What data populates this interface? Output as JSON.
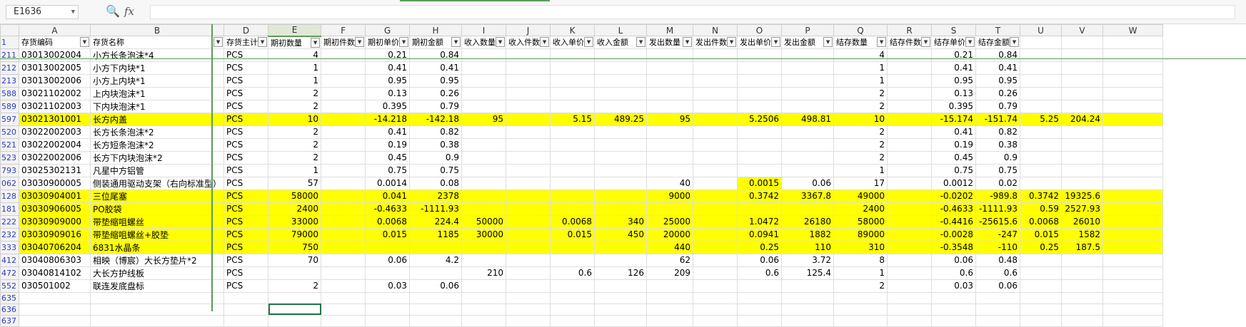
{
  "formula_bar": {
    "name_box": "E1636",
    "zoom_icon": "zoom-icon",
    "fx_label": "fx",
    "formula_value": ""
  },
  "sheet": {
    "columns": [
      "A",
      "B",
      "D",
      "E",
      "F",
      "G",
      "H",
      "I",
      "J",
      "K",
      "L",
      "M",
      "N",
      "O",
      "P",
      "Q",
      "R",
      "S",
      "T",
      "U",
      "V",
      "W"
    ],
    "header_row_number": "1",
    "headers": [
      "存货编码",
      "存货名称",
      "存货主计",
      "期初数量",
      "期初件数",
      "期初单价",
      "期初金额",
      "收入数量",
      "收入件数",
      "收入单价",
      "收入金额",
      "发出数量",
      "发出件数",
      "发出单价",
      "发出金额",
      "结存数量",
      "结存件数",
      "结存单价",
      "结存金额",
      "",
      "",
      ""
    ],
    "rows": [
      {
        "rn": "211",
        "hl": false,
        "cells": [
          "03013002004",
          "小方长条泡沫*4",
          "PCS",
          "4",
          "",
          "0.21",
          "0.84",
          "",
          "",
          "",
          "",
          "",
          "",
          "",
          "",
          "4",
          "",
          "0.21",
          "0.84",
          "",
          "",
          ""
        ]
      },
      {
        "rn": "212",
        "hl": false,
        "cells": [
          "03013002005",
          "小方下内块*1",
          "PCS",
          "1",
          "",
          "0.41",
          "0.41",
          "",
          "",
          "",
          "",
          "",
          "",
          "",
          "",
          "1",
          "",
          "0.41",
          "0.41",
          "",
          "",
          ""
        ]
      },
      {
        "rn": "213",
        "hl": false,
        "cells": [
          "03013002006",
          "小方上内块*1",
          "PCS",
          "1",
          "",
          "0.95",
          "0.95",
          "",
          "",
          "",
          "",
          "",
          "",
          "",
          "",
          "1",
          "",
          "0.95",
          "0.95",
          "",
          "",
          ""
        ]
      },
      {
        "rn": "588",
        "hl": false,
        "cells": [
          "03021102002",
          "上内块泡沫*1",
          "PCS",
          "2",
          "",
          "0.13",
          "0.26",
          "",
          "",
          "",
          "",
          "",
          "",
          "",
          "",
          "2",
          "",
          "0.13",
          "0.26",
          "",
          "",
          ""
        ]
      },
      {
        "rn": "589",
        "hl": false,
        "cells": [
          "03021102003",
          "下内块泡沫*1",
          "PCS",
          "2",
          "",
          "0.395",
          "0.79",
          "",
          "",
          "",
          "",
          "",
          "",
          "",
          "",
          "2",
          "",
          "0.395",
          "0.79",
          "",
          "",
          ""
        ]
      },
      {
        "rn": "597",
        "hl": true,
        "cells": [
          "03021301001",
          "长方内盖",
          "PCS",
          "10",
          "",
          "-14.218",
          "-142.18",
          "95",
          "",
          "5.15",
          "489.25",
          "95",
          "",
          "5.2506",
          "498.81",
          "10",
          "",
          "-15.174",
          "-151.74",
          "5.25",
          "204.24",
          ""
        ]
      },
      {
        "rn": "520",
        "hl": false,
        "cells": [
          "03022002003",
          "长方长条泡沫*2",
          "PCS",
          "2",
          "",
          "0.41",
          "0.82",
          "",
          "",
          "",
          "",
          "",
          "",
          "",
          "",
          "2",
          "",
          "0.41",
          "0.82",
          "",
          "",
          ""
        ]
      },
      {
        "rn": "521",
        "hl": false,
        "cells": [
          "03022002004",
          "长方短条泡沫*2",
          "PCS",
          "2",
          "",
          "0.19",
          "0.38",
          "",
          "",
          "",
          "",
          "",
          "",
          "",
          "",
          "2",
          "",
          "0.19",
          "0.38",
          "",
          "",
          ""
        ]
      },
      {
        "rn": "523",
        "hl": false,
        "cells": [
          "03022002006",
          "长方下内块泡沫*2",
          "PCS",
          "2",
          "",
          "0.45",
          "0.9",
          "",
          "",
          "",
          "",
          "",
          "",
          "",
          "",
          "2",
          "",
          "0.45",
          "0.9",
          "",
          "",
          ""
        ]
      },
      {
        "rn": "793",
        "hl": false,
        "cells": [
          "03025302131",
          "凡星中方铝管",
          "PCS",
          "1",
          "",
          "0.75",
          "0.75",
          "",
          "",
          "",
          "",
          "",
          "",
          "",
          "",
          "1",
          "",
          "0.75",
          "0.75",
          "",
          "",
          ""
        ]
      },
      {
        "rn": "062",
        "hl": false,
        "cells": [
          "03030900005",
          "侧装通用驱动支架（右向标准型）",
          "PCS",
          "57",
          "",
          "0.0014",
          "0.08",
          "",
          "",
          "",
          "",
          "40",
          "",
          "0.0015",
          "0.06",
          "17",
          "",
          "0.0012",
          "0.02",
          "",
          "",
          ""
        ]
      },
      {
        "rn": "128",
        "hl": true,
        "cells": [
          "03030904001",
          "三位尾塞",
          "PCS",
          "58000",
          "",
          "0.041",
          "2378",
          "",
          "",
          "",
          "",
          "9000",
          "",
          "0.3742",
          "3367.8",
          "49000",
          "",
          "-0.0202",
          "-989.8",
          "0.3742",
          "19325.6",
          ""
        ]
      },
      {
        "rn": "181",
        "hl": true,
        "cells": [
          "03030906005",
          "PO胶袋",
          "PCS",
          "2400",
          "",
          "-0.4633",
          "-1111.93",
          "",
          "",
          "",
          "",
          "",
          "",
          "",
          "",
          "2400",
          "",
          "-0.4633",
          "-1111.93",
          "0.59",
          "2527.93",
          ""
        ]
      },
      {
        "rn": "222",
        "hl": true,
        "cells": [
          "03030909000",
          "带垫缩咀螺丝",
          "PCS",
          "33000",
          "",
          "0.0068",
          "224.4",
          "50000",
          "",
          "0.0068",
          "340",
          "25000",
          "",
          "1.0472",
          "26180",
          "58000",
          "",
          "-0.4416",
          "-25615.6",
          "0.0068",
          "26010",
          ""
        ]
      },
      {
        "rn": "232",
        "hl": true,
        "cells": [
          "03030909016",
          "带垫缩咀螺丝+胶垫",
          "PCS",
          "79000",
          "",
          "0.015",
          "1185",
          "30000",
          "",
          "0.015",
          "450",
          "20000",
          "",
          "0.0941",
          "1882",
          "89000",
          "",
          "-0.0028",
          "-247",
          "0.015",
          "1582",
          ""
        ]
      },
      {
        "rn": "333",
        "hl": true,
        "cells": [
          "03040706204",
          "6831水晶条",
          "PCS",
          "750",
          "",
          "",
          "",
          "",
          "",
          "",
          "",
          "440",
          "",
          "0.25",
          "110",
          "310",
          "",
          "-0.3548",
          "-110",
          "0.25",
          "187.5",
          ""
        ]
      },
      {
        "rn": "412",
        "hl": false,
        "cells": [
          "03040806303",
          "相映（博宸）大长方垫片*2",
          "PCS",
          "70",
          "",
          "0.06",
          "4.2",
          "",
          "",
          "",
          "",
          "62",
          "",
          "0.06",
          "3.72",
          "8",
          "",
          "0.06",
          "0.48",
          "",
          "",
          ""
        ]
      },
      {
        "rn": "472",
        "hl": false,
        "cells": [
          "03040814102",
          "大长方护线板",
          "PCS",
          "",
          "",
          "",
          "",
          "210",
          "",
          "0.6",
          "126",
          "209",
          "",
          "0.6",
          "125.4",
          "1",
          "",
          "0.6",
          "0.6",
          "",
          "",
          ""
        ]
      },
      {
        "rn": "552",
        "hl": false,
        "cells": [
          "030501002",
          "联连发底盘标",
          "PCS",
          "2",
          "",
          "0.03",
          "0.06",
          "",
          "",
          "",
          "",
          "",
          "",
          "",
          "",
          "2",
          "",
          "0.03",
          "0.06",
          "",
          "",
          ""
        ]
      },
      {
        "rn": "635",
        "hl": false,
        "cells": [
          "",
          "",
          "",
          "",
          "",
          "",
          "",
          "",
          "",
          "",
          "",
          "",
          "",
          "",
          "",
          "",
          "",
          "",
          "",
          "",
          "",
          ""
        ]
      },
      {
        "rn": "636",
        "hl": false,
        "cells": [
          "",
          "",
          "",
          "",
          "",
          "",
          "",
          "",
          "",
          "",
          "",
          "",
          "",
          "",
          "",
          "",
          "",
          "",
          "",
          "",
          "",
          ""
        ]
      },
      {
        "rn": "637",
        "hl": false,
        "cells": [
          "",
          "",
          "",
          "",
          "",
          "",
          "",
          "",
          "",
          "",
          "",
          "",
          "",
          "",
          "",
          "",
          "",
          "",
          "",
          "",
          "",
          ""
        ]
      }
    ]
  },
  "colors": {
    "highlight": "#ffff00",
    "selection": "#217346",
    "freeze_line": "#5b9b5b",
    "row_number_text": "#2b3cbf"
  }
}
